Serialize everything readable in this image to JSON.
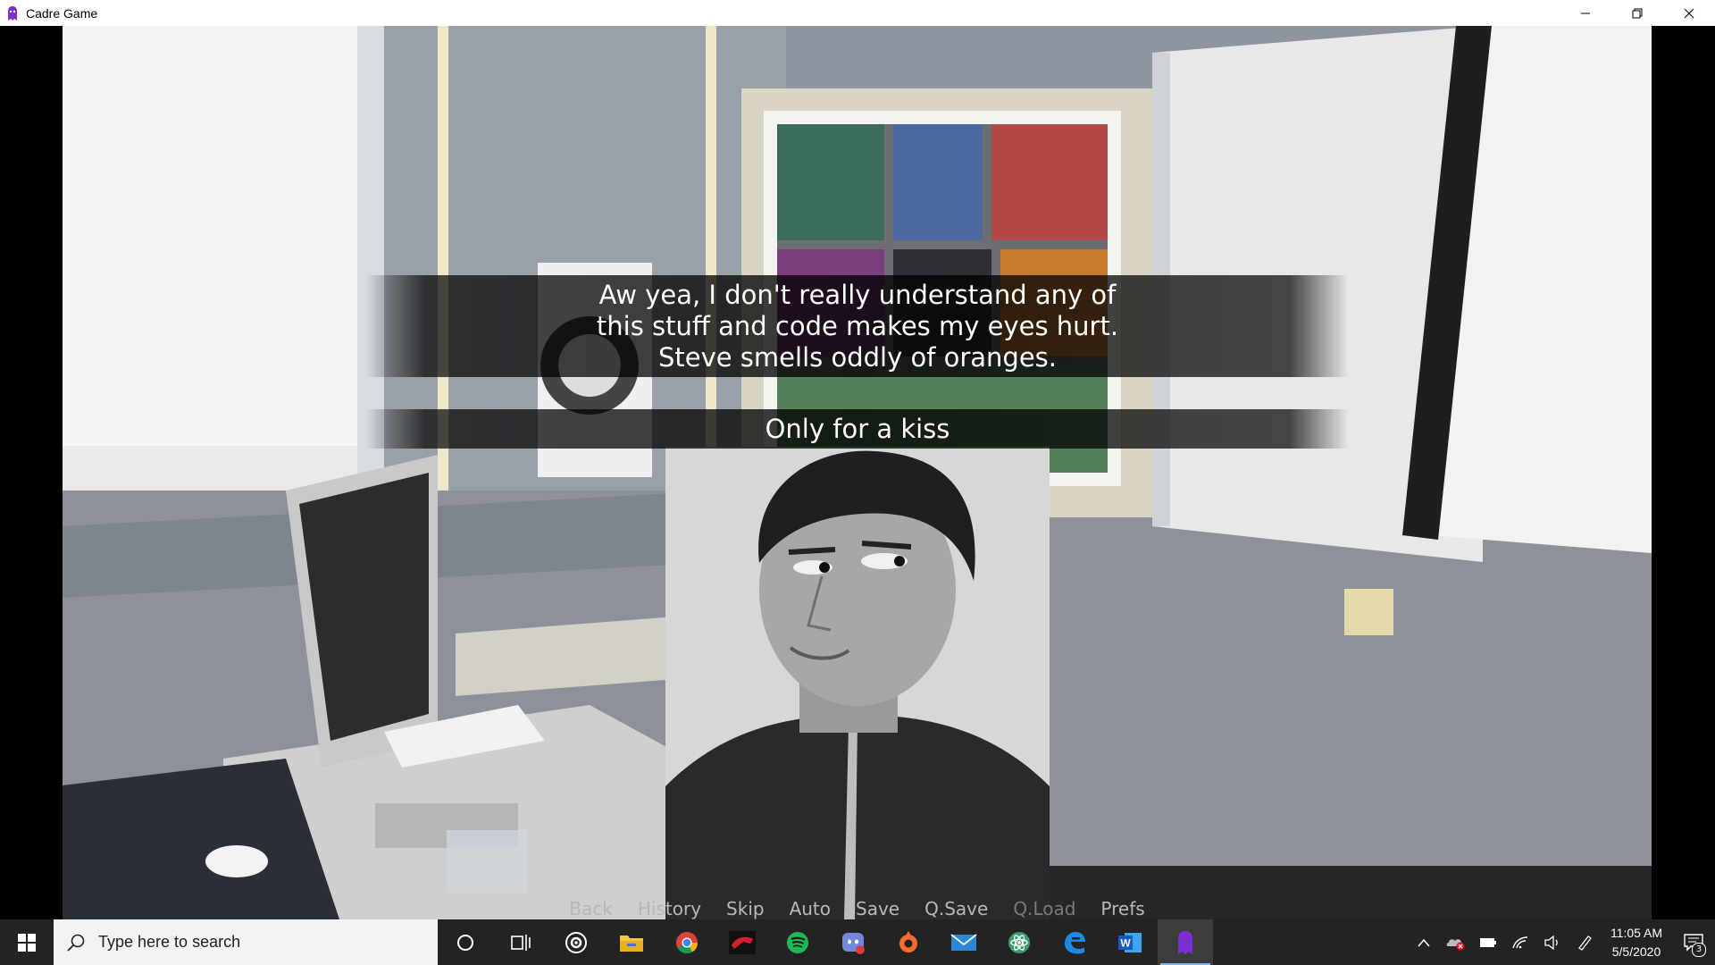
{
  "window": {
    "title": "Cadre Game",
    "icon": "cadre-game-icon",
    "controls": [
      "minimize-icon",
      "restore-icon",
      "close-icon"
    ]
  },
  "game": {
    "dialogue": "Aw yea, I don't really understand any of this stuff and code makes my eyes hurt. Steve smells oddly of oranges.",
    "choice": "Only for a kiss",
    "quick_menu": [
      {
        "label": "Back",
        "enabled": true
      },
      {
        "label": "History",
        "enabled": true
      },
      {
        "label": "Skip",
        "enabled": true
      },
      {
        "label": "Auto",
        "enabled": true
      },
      {
        "label": "Save",
        "enabled": true
      },
      {
        "label": "Q.Save",
        "enabled": true
      },
      {
        "label": "Q.Load",
        "enabled": false
      },
      {
        "label": "Prefs",
        "enabled": true
      }
    ]
  },
  "taskbar": {
    "search_placeholder": "Type here to search",
    "pinned": [
      {
        "icon": "cortana-icon",
        "active": false
      },
      {
        "icon": "task-view-icon",
        "active": false
      },
      {
        "icon": "steam-icon",
        "active": false
      },
      {
        "icon": "file-explorer-icon",
        "active": false
      },
      {
        "icon": "chrome-icon",
        "active": false
      },
      {
        "icon": "game-app-icon",
        "active": false
      },
      {
        "icon": "spotify-icon",
        "active": false
      },
      {
        "icon": "discord-icon",
        "active": false
      },
      {
        "icon": "origin-icon",
        "active": false
      },
      {
        "icon": "mail-icon",
        "active": false
      },
      {
        "icon": "atom-icon",
        "active": false
      },
      {
        "icon": "edge-icon",
        "active": false
      },
      {
        "icon": "word-icon",
        "active": false
      },
      {
        "icon": "cadre-game-icon",
        "active": true
      }
    ],
    "tray_icons": [
      "show-hidden-icons-chevron",
      "onedrive-error-icon",
      "battery-icon",
      "wifi-icon",
      "volume-icon",
      "pen-icon"
    ],
    "time": "11:05 AM",
    "date": "5/5/2020",
    "notification_count": "3"
  },
  "colors": {
    "titlebar_bg": "#ffffff",
    "taskbar_bg": "#232323",
    "menu_text": "#b8b8b8",
    "menu_text_disabled": "#7a7a7a",
    "cadre_purple": "#7a2fd0"
  }
}
